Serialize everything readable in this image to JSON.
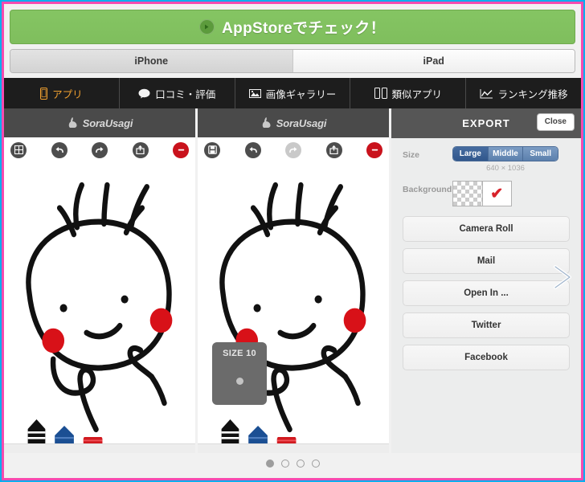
{
  "frame": {
    "outer_color": "#00aeef",
    "inner_color": "#f74bb0"
  },
  "banner": {
    "label": "AppStoreでチェック！",
    "icon": "arrow-right-circle-icon",
    "bg_color": "#7fbe5d"
  },
  "device_tabs": [
    {
      "label": "iPhone",
      "active": true
    },
    {
      "label": "iPad",
      "active": false
    }
  ],
  "nav": {
    "items": [
      {
        "label": "アプリ",
        "icon": "phone-icon",
        "active": true
      },
      {
        "label": "口コミ・評価",
        "icon": "speech-bubble-icon",
        "active": false
      },
      {
        "label": "画像ギャラリー",
        "icon": "image-icon",
        "active": false
      },
      {
        "label": "類似アプリ",
        "icon": "two-phones-icon",
        "active": false
      },
      {
        "label": "ランキング推移",
        "icon": "line-chart-icon",
        "active": false
      }
    ],
    "active_color": "#f0a030",
    "bg_color": "#1d1d1d"
  },
  "screenshots": [
    {
      "app_title": "SoraUsagi",
      "toolbar": [
        {
          "icon": "grid-icon",
          "state": "enabled"
        },
        {
          "icon": "undo-icon",
          "state": "enabled"
        },
        {
          "icon": "redo-icon",
          "state": "enabled"
        },
        {
          "icon": "share-icon",
          "state": "enabled"
        },
        {
          "icon": "delete-icon",
          "state": "danger"
        }
      ],
      "size_popup": null
    },
    {
      "app_title": "SoraUsagi",
      "toolbar": [
        {
          "icon": "save-icon",
          "state": "enabled"
        },
        {
          "icon": "undo-icon",
          "state": "enabled"
        },
        {
          "icon": "redo-icon",
          "state": "disabled"
        },
        {
          "icon": "share-icon",
          "state": "enabled"
        },
        {
          "icon": "delete-icon",
          "state": "danger"
        }
      ],
      "size_popup": {
        "label": "SIZE 10"
      }
    }
  ],
  "export": {
    "title": "EXPORT",
    "close_label": "Close",
    "size_label": "Size",
    "size_options": [
      {
        "label": "Large",
        "active": true
      },
      {
        "label": "Middle",
        "active": false
      },
      {
        "label": "Small",
        "active": false
      }
    ],
    "dimensions": "640 × 1036",
    "background_label": "Background",
    "background_options": [
      {
        "name": "transparent",
        "selected": false
      },
      {
        "name": "white",
        "selected": true
      }
    ],
    "check_color": "#d8222a",
    "actions": [
      {
        "label": "Camera Roll"
      },
      {
        "label": "Mail"
      },
      {
        "label": "Open In ..."
      },
      {
        "label": "Twitter"
      },
      {
        "label": "Facebook"
      }
    ],
    "next_icon": "chevron-right-icon"
  },
  "pagination": {
    "total": 4,
    "active_index": 0
  },
  "tools": {
    "pens": [
      {
        "name": "black-pen",
        "color": "#111111",
        "selected": true
      },
      {
        "name": "blue-crayon",
        "color": "#1b4f93",
        "selected": false
      },
      {
        "name": "red-crayon",
        "color": "#d11a20",
        "selected": false
      }
    ]
  }
}
